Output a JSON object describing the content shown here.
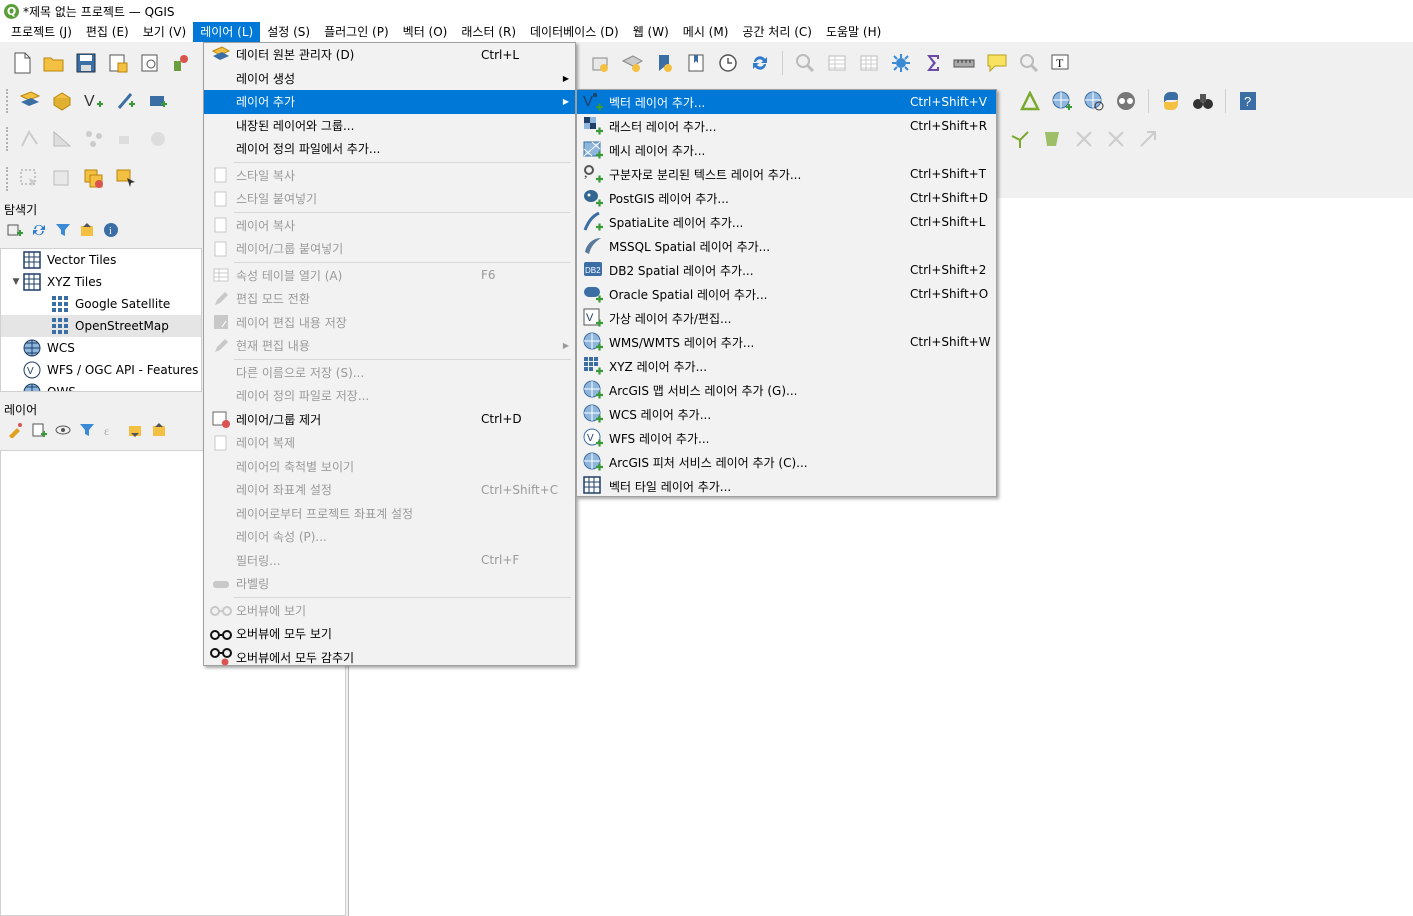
{
  "window": {
    "title": "*제목 없는 프로젝트 — QGIS",
    "logo_letter": "Q"
  },
  "menubar": [
    {
      "label": "프로젝트 (J)"
    },
    {
      "label": "편집 (E)"
    },
    {
      "label": "보기 (V)"
    },
    {
      "label": "레이어 (L)",
      "active": true
    },
    {
      "label": "설정 (S)"
    },
    {
      "label": "플러그인 (P)"
    },
    {
      "label": "벡터 (O)"
    },
    {
      "label": "래스터 (R)"
    },
    {
      "label": "데이터베이스 (D)"
    },
    {
      "label": "웹 (W)"
    },
    {
      "label": "메시 (M)"
    },
    {
      "label": "공간 처리 (C)"
    },
    {
      "label": "도움말 (H)"
    }
  ],
  "browser_panel": {
    "title": "탐색기",
    "items": [
      {
        "label": "Vector Tiles",
        "icon": "grid-icon"
      },
      {
        "label": "XYZ Tiles",
        "icon": "grid-icon",
        "expanded": true
      },
      {
        "label": "Google Satellite",
        "icon": "tile-icon"
      },
      {
        "label": "OpenStreetMap",
        "icon": "tile-icon",
        "selected": true
      },
      {
        "label": "WCS",
        "icon": "globe-icon"
      },
      {
        "label": "WFS / OGC API - Features",
        "icon": "wfs-icon"
      },
      {
        "label": "OWS",
        "icon": "globe-icon"
      }
    ]
  },
  "layers_panel": {
    "title": "레이어"
  },
  "layer_menu": {
    "items": [
      {
        "label": "데이터 원본 관리자 (D)",
        "shortcut": "Ctrl+L",
        "icon": "data-source-icon",
        "enabled": true
      },
      {
        "label": "레이어 생성",
        "shortcut": "",
        "submenu": true,
        "enabled": true
      },
      {
        "label": "레이어 추가",
        "shortcut": "",
        "submenu": true,
        "enabled": true,
        "highlighted": true
      },
      {
        "label": "내장된 레이어와 그룹...",
        "shortcut": "",
        "enabled": true
      },
      {
        "label": "레이어 정의 파일에서 추가...",
        "shortcut": "",
        "enabled": true,
        "sep_after": true
      },
      {
        "label": "스타일 복사",
        "shortcut": "",
        "enabled": false,
        "icon": "copy-icon"
      },
      {
        "label": "스타일 붙여넣기",
        "shortcut": "",
        "enabled": false,
        "icon": "paste-icon",
        "sep_after": true
      },
      {
        "label": "레이어 복사",
        "shortcut": "",
        "enabled": false,
        "icon": "copy-icon"
      },
      {
        "label": "레이어/그룹 붙여넣기",
        "shortcut": "",
        "enabled": false,
        "icon": "paste-icon",
        "sep_after": true
      },
      {
        "label": "속성 테이블 열기 (A)",
        "shortcut": "F6",
        "enabled": false,
        "icon": "table-icon"
      },
      {
        "label": "편집 모드 전환",
        "shortcut": "",
        "enabled": false,
        "icon": "pencil-icon"
      },
      {
        "label": "레이어 편집 내용 저장",
        "shortcut": "",
        "enabled": false,
        "icon": "save-edits-icon"
      },
      {
        "label": "현재 편집 내용",
        "shortcut": "",
        "enabled": false,
        "icon": "pencil-icon",
        "submenu": true,
        "sep_after": true
      },
      {
        "label": "다른 이름으로 저장 (S)...",
        "shortcut": "",
        "enabled": false
      },
      {
        "label": "레이어 정의 파일로 저장...",
        "shortcut": "",
        "enabled": false
      },
      {
        "label": "레이어/그룹 제거",
        "shortcut": "Ctrl+D",
        "enabled": true,
        "icon": "remove-layer-icon"
      },
      {
        "label": "레이어 복제",
        "shortcut": "",
        "enabled": false,
        "icon": "duplicate-icon"
      },
      {
        "label": "레이어의 축척별 보이기",
        "shortcut": "",
        "enabled": false
      },
      {
        "label": "레이어 좌표계 설정",
        "shortcut": "Ctrl+Shift+C",
        "enabled": false
      },
      {
        "label": "레이어로부터 프로젝트 좌표계 설정",
        "shortcut": "",
        "enabled": false
      },
      {
        "label": "레이어 속성 (P)...",
        "shortcut": "",
        "enabled": false
      },
      {
        "label": "필터링...",
        "shortcut": "Ctrl+F",
        "enabled": false
      },
      {
        "label": "라벨링",
        "shortcut": "",
        "enabled": false,
        "icon": "label-icon",
        "sep_after": true
      },
      {
        "label": "오버뷰에 보기",
        "shortcut": "",
        "enabled": false,
        "icon": "glasses-icon"
      },
      {
        "label": "오버뷰에 모두 보기",
        "shortcut": "",
        "enabled": true,
        "icon": "glasses-icon"
      },
      {
        "label": "오버뷰에서 모두 감추기",
        "shortcut": "",
        "enabled": true,
        "icon": "glasses-hide-icon"
      }
    ]
  },
  "add_layer_submenu": {
    "items": [
      {
        "label": "벡터 레이어 추가...",
        "shortcut": "Ctrl+Shift+V",
        "icon": "vector-layer-icon",
        "highlighted": true
      },
      {
        "label": "래스터 레이어 추가...",
        "shortcut": "Ctrl+Shift+R",
        "icon": "raster-layer-icon"
      },
      {
        "label": "메시 레이어 추가...",
        "shortcut": "",
        "icon": "mesh-layer-icon"
      },
      {
        "label": "구분자로 분리된 텍스트 레이어 추가...",
        "shortcut": "Ctrl+Shift+T",
        "icon": "delimited-text-icon"
      },
      {
        "label": "PostGIS 레이어 추가...",
        "shortcut": "Ctrl+Shift+D",
        "icon": "postgis-icon"
      },
      {
        "label": "SpatiaLite 레이어 추가...",
        "shortcut": "Ctrl+Shift+L",
        "icon": "spatialite-icon"
      },
      {
        "label": "MSSQL Spatial 레이어 추가...",
        "shortcut": "",
        "icon": "mssql-icon"
      },
      {
        "label": "DB2 Spatial 레이어 추가...",
        "shortcut": "Ctrl+Shift+2",
        "icon": "db2-icon"
      },
      {
        "label": "Oracle Spatial 레이어 추가...",
        "shortcut": "Ctrl+Shift+O",
        "icon": "oracle-icon"
      },
      {
        "label": "가상 레이어 추가/편집...",
        "shortcut": "",
        "icon": "virtual-layer-icon"
      },
      {
        "label": "WMS/WMTS 레이어 추가...",
        "shortcut": "Ctrl+Shift+W",
        "icon": "wms-icon"
      },
      {
        "label": "XYZ 레이어 추가...",
        "shortcut": "",
        "icon": "xyz-icon"
      },
      {
        "label": "ArcGIS 맵 서비스 레이어 추가 (G)...",
        "shortcut": "",
        "icon": "arcgis-map-icon"
      },
      {
        "label": "WCS 레이어 추가...",
        "shortcut": "",
        "icon": "wcs-icon"
      },
      {
        "label": "WFS 레이어 추가...",
        "shortcut": "",
        "icon": "wfs-icon"
      },
      {
        "label": "ArcGIS 피처 서비스 레이어 추가 (C)...",
        "shortcut": "",
        "icon": "arcgis-feature-icon"
      },
      {
        "label": "벡터 타일 레이어 추가...",
        "shortcut": "",
        "icon": "vector-tile-icon"
      }
    ]
  },
  "colors": {
    "highlight": "#0078d7",
    "disabled_text": "#9a9a9a"
  }
}
